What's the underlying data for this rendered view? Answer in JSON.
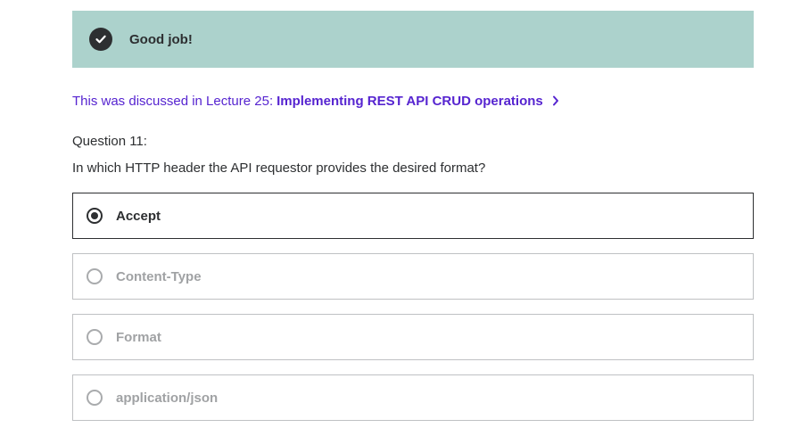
{
  "banner": {
    "title": "Good job!",
    "icon": "check-circle-icon",
    "background_color": "#acd2cc"
  },
  "lecture_ref": {
    "prefix": "This was discussed in Lecture 25:",
    "link_text": "Implementing REST API CRUD operations",
    "icon": "chevron-right-icon",
    "color": "#5624d0"
  },
  "question": {
    "number_label": "Question 11:",
    "text": "In which HTTP header the API requestor provides the desired format?"
  },
  "options": [
    {
      "label": "Accept",
      "selected": true
    },
    {
      "label": "Content-Type",
      "selected": false
    },
    {
      "label": "Format",
      "selected": false
    },
    {
      "label": "application/json",
      "selected": false
    }
  ]
}
